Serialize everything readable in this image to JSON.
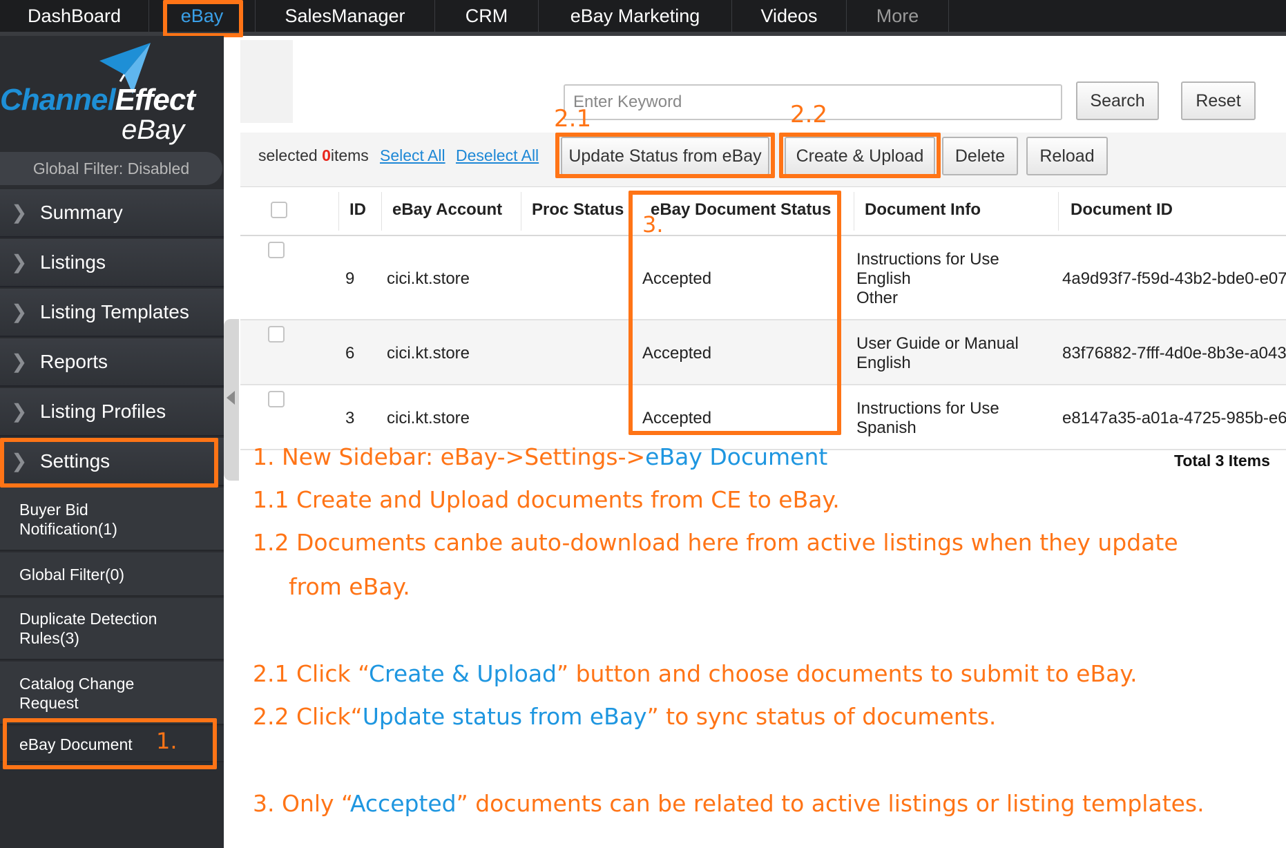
{
  "topnav": {
    "items": [
      "DashBoard",
      "eBay",
      "SalesManager",
      "CRM",
      "eBay Marketing",
      "Videos",
      "More"
    ]
  },
  "sidebar": {
    "logo": {
      "brand_left": "Channel",
      "brand_right": "Effect",
      "sub": "eBay"
    },
    "global_filter": "Global Filter: Disabled",
    "items": [
      "Summary",
      "Listings",
      "Listing Templates",
      "Reports",
      "Listing Profiles",
      "Settings"
    ],
    "sub_items": [
      "Buyer Bid Notification(1)",
      "Global Filter(0)",
      "Duplicate Detection Rules(3)",
      "Catalog Change Request",
      "eBay Document"
    ]
  },
  "search": {
    "placeholder": "Enter Keyword",
    "search_label": "Search",
    "reset_label": "Reset"
  },
  "toolbar": {
    "selected_prefix": "selected ",
    "selected_count": "0",
    "selected_suffix": "items",
    "select_all": "Select All",
    "deselect_all": "Deselect All",
    "update_status": "Update Status from eBay",
    "create_upload": "Create & Upload",
    "delete": "Delete",
    "reload": "Reload"
  },
  "table": {
    "columns": [
      "ID",
      "eBay Account",
      "Proc Status",
      "eBay Document Status",
      "Document Info",
      "Document ID"
    ],
    "rows": [
      {
        "id": "9",
        "account": "cici.kt.store",
        "proc_status": "",
        "doc_status": "Accepted",
        "info": [
          "Instructions for Use",
          "English",
          "Other"
        ],
        "doc_id": "4a9d93f7-f59d-43b2-bde0-e07"
      },
      {
        "id": "6",
        "account": "cici.kt.store",
        "proc_status": "",
        "doc_status": "Accepted",
        "info": [
          "User Guide or Manual",
          "English"
        ],
        "doc_id": "83f76882-7fff-4d0e-8b3e-a043"
      },
      {
        "id": "3",
        "account": "cici.kt.store",
        "proc_status": "",
        "doc_status": "Accepted",
        "info": [
          "Instructions for Use",
          "Spanish"
        ],
        "doc_id": "e8147a35-a01a-4725-985b-e6"
      }
    ],
    "total": "Total 3 Items"
  },
  "annotations": {
    "labels": {
      "step_1": "1.",
      "step_2_1": "2.1",
      "step_2_2": "2.2",
      "step_3": "3."
    },
    "note_1_a": "1. New Sidebar:  eBay->Settings->",
    "note_1_b": "eBay Document",
    "note_1_1": "1.1 Create and Upload documents from CE  to eBay.",
    "note_1_2_line1": "1.2 Documents canbe auto-download here from active listings when they update",
    "note_1_2_line2": "from eBay.",
    "note_2_1_a": "2.1  Click “",
    "note_2_1_b": "Create & Upload",
    "note_2_1_c": "” button and choose documents to submit to eBay.",
    "note_2_2_a": "2.2 Click“",
    "note_2_2_b": "Update status from eBay",
    "note_2_2_c": "” to sync status of documents.",
    "note_3_a": "3. Only “",
    "note_3_b": "Accepted",
    "note_3_c": "” documents can be related to active listings or listing templates."
  },
  "colors": {
    "highlight": "#ff7416",
    "accent_blue": "#1e96e0",
    "nav_bg": "#1c1d1f",
    "sidebar_bg": "#2b2d31"
  }
}
